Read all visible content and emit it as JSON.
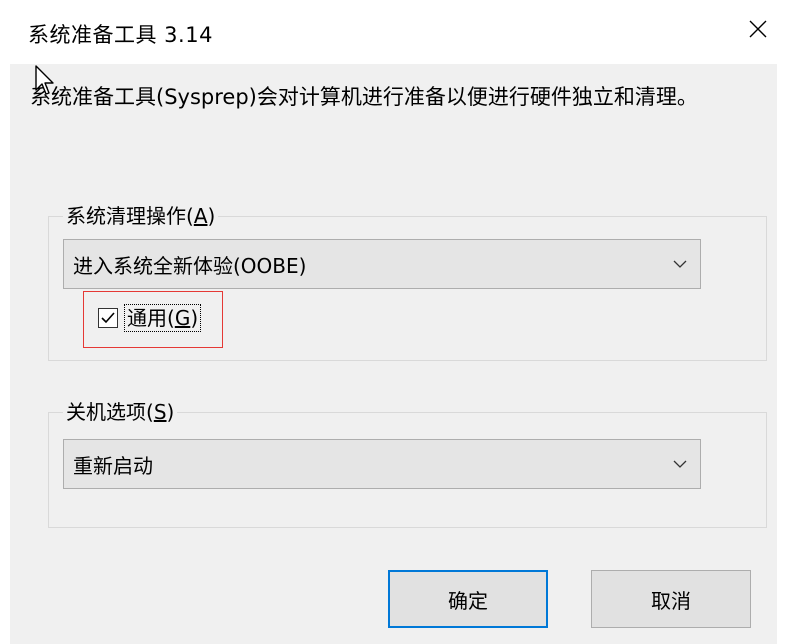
{
  "window": {
    "title": "系统准备工具 3.14",
    "close_icon": "close-icon"
  },
  "description": "系统准备工具(Sysprep)会对计算机进行准备以便进行硬件独立和清理。",
  "cleanup_group": {
    "label_prefix": "系统清理操作(",
    "mnemonic": "A",
    "label_suffix": ")",
    "selected_option": "进入系统全新体验(OOBE)",
    "generalize": {
      "label_prefix": "通用(",
      "mnemonic": "G",
      "label_suffix": ")",
      "checked": true
    }
  },
  "shutdown_group": {
    "label_prefix": "关机选项(",
    "mnemonic": "S",
    "label_suffix": ")",
    "selected_option": "重新启动"
  },
  "buttons": {
    "ok": "确定",
    "cancel": "取消"
  },
  "colors": {
    "highlight_border": "#e53935",
    "default_button_border": "#0078d7",
    "dialog_background": "#f0f0f0"
  }
}
